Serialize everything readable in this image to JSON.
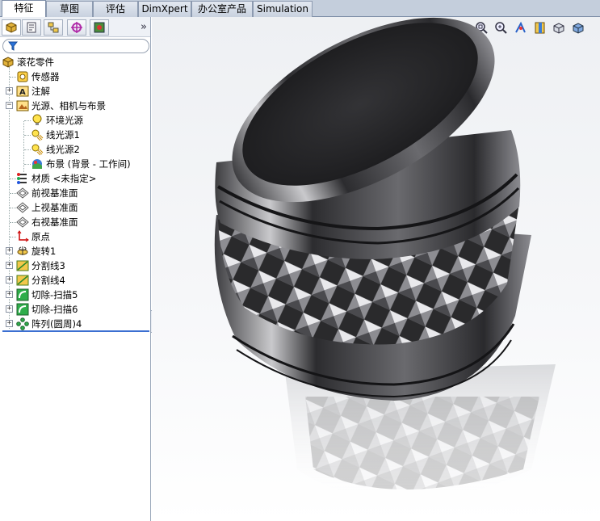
{
  "tabs": [
    "特征",
    "草图",
    "评估",
    "DimXpert",
    "办公室产品",
    "Simulation"
  ],
  "active_tab": "特征",
  "panel_tools": [
    "feature-manager-icon",
    "property-manager-icon",
    "configuration-manager-icon",
    "dimxpert-manager-icon",
    "display-manager-icon"
  ],
  "tree": {
    "root": "滚花零件",
    "items": [
      {
        "label": "传感器",
        "icon": "sensor-icon"
      },
      {
        "label": "注解",
        "icon": "annotation-icon"
      },
      {
        "label": "光源、相机与布景",
        "icon": "lights-cameras-scene-icon"
      },
      {
        "label": "环境光源",
        "icon": "ambient-light-icon"
      },
      {
        "label": "线光源1",
        "icon": "directional-light-icon"
      },
      {
        "label": "线光源2",
        "icon": "directional-light-icon"
      },
      {
        "label": "布景 (背景 - 工作间)",
        "icon": "scene-icon"
      },
      {
        "label": "材质 <未指定>",
        "icon": "material-icon"
      },
      {
        "label": "前视基准面",
        "icon": "plane-icon"
      },
      {
        "label": "上视基准面",
        "icon": "plane-icon"
      },
      {
        "label": "右视基准面",
        "icon": "plane-icon"
      },
      {
        "label": "原点",
        "icon": "origin-icon"
      },
      {
        "label": "旋转1",
        "icon": "revolve-icon"
      },
      {
        "label": "分割线3",
        "icon": "split-line-icon"
      },
      {
        "label": "分割线4",
        "icon": "split-line-icon"
      },
      {
        "label": "切除-扫描5",
        "icon": "cut-sweep-icon"
      },
      {
        "label": "切除-扫描6",
        "icon": "cut-sweep-icon"
      },
      {
        "label": "阵列(圆周)4",
        "icon": "circular-pattern-icon"
      }
    ]
  },
  "view_tools": [
    "zoom-to-fit-icon",
    "zoom-to-area-icon",
    "previous-view-icon",
    "section-view-icon",
    "view-orientation-icon",
    "display-style-icon"
  ],
  "colors": {
    "accent": "#3b6fd1",
    "tab_bg": "#c4cedc",
    "panel_border": "#9aa7ba"
  }
}
